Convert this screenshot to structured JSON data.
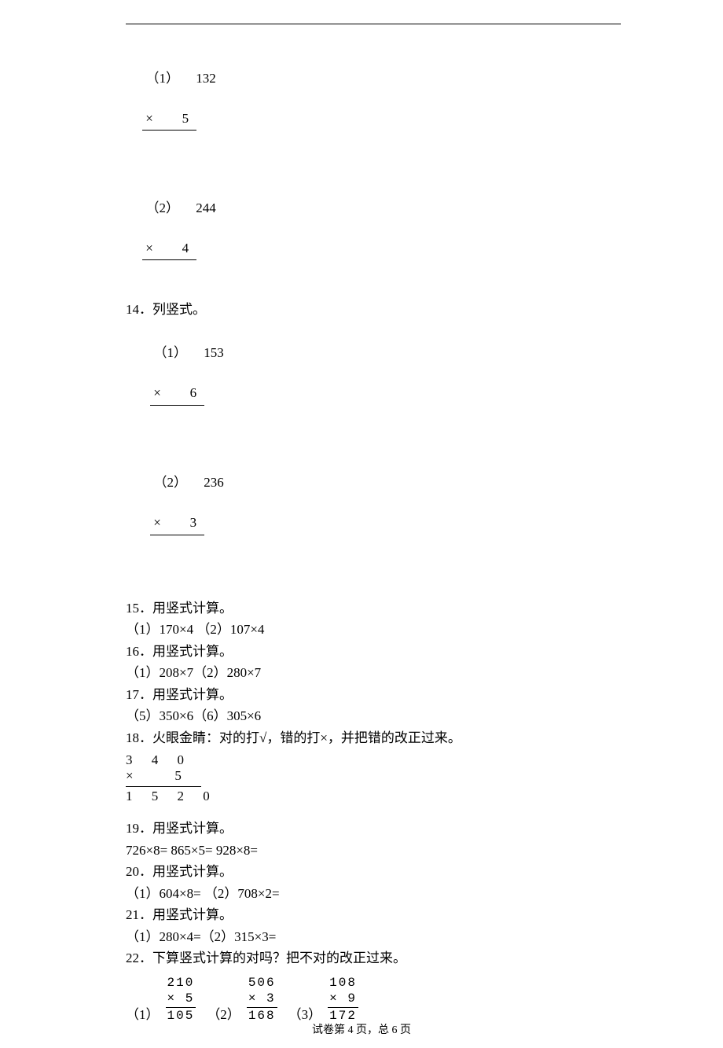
{
  "q13": {
    "p1": {
      "label": "（1）",
      "top": "132",
      "mult": "×   5"
    },
    "p2": {
      "label": "（2）",
      "top": "244",
      "mult": "×   4"
    }
  },
  "q14": {
    "title": "14．列竖式。",
    "p1": {
      "label": "（1）",
      "top": "153",
      "mult": "×   6"
    },
    "p2": {
      "label": "（2）",
      "top": "236",
      "mult": "×   3"
    }
  },
  "q15": {
    "title": "15．用竖式计算。",
    "line": "（1）170×4    （2）107×4"
  },
  "q16": {
    "title": "16．用竖式计算。",
    "line": "（1）208×7（2）280×7"
  },
  "q17": {
    "title": "17．用竖式计算。",
    "line": "（5）350×6（6）305×6"
  },
  "q18": {
    "title": "18．火眼金睛：对的打√，错的打×，并把错的改正过来。",
    "row1": "3 4 0",
    "row2": "×   5",
    "row3": "1 5 2 0"
  },
  "q19": {
    "title": "19．用竖式计算。",
    "line": "726×8=    865×5=    928×8="
  },
  "q20": {
    "title": "20．用竖式计算。",
    "line": "（1）604×8=   （2）708×2="
  },
  "q21": {
    "title": "21．用竖式计算。",
    "line": "（1）280×4=（2）315×3="
  },
  "q22": {
    "title": "22．下算竖式计算的对吗？把不对的改正过来。",
    "items": [
      {
        "lbl": "（1）",
        "top": "210",
        "mult": "×  5 ",
        "res": "105"
      },
      {
        "lbl": "（2）",
        "top": "506",
        "mult": "×  3 ",
        "res": "168"
      },
      {
        "lbl": "（3）",
        "top": "108",
        "mult": "×  9 ",
        "res": "172"
      }
    ]
  },
  "footer": "试卷第 4 页，总 6 页"
}
